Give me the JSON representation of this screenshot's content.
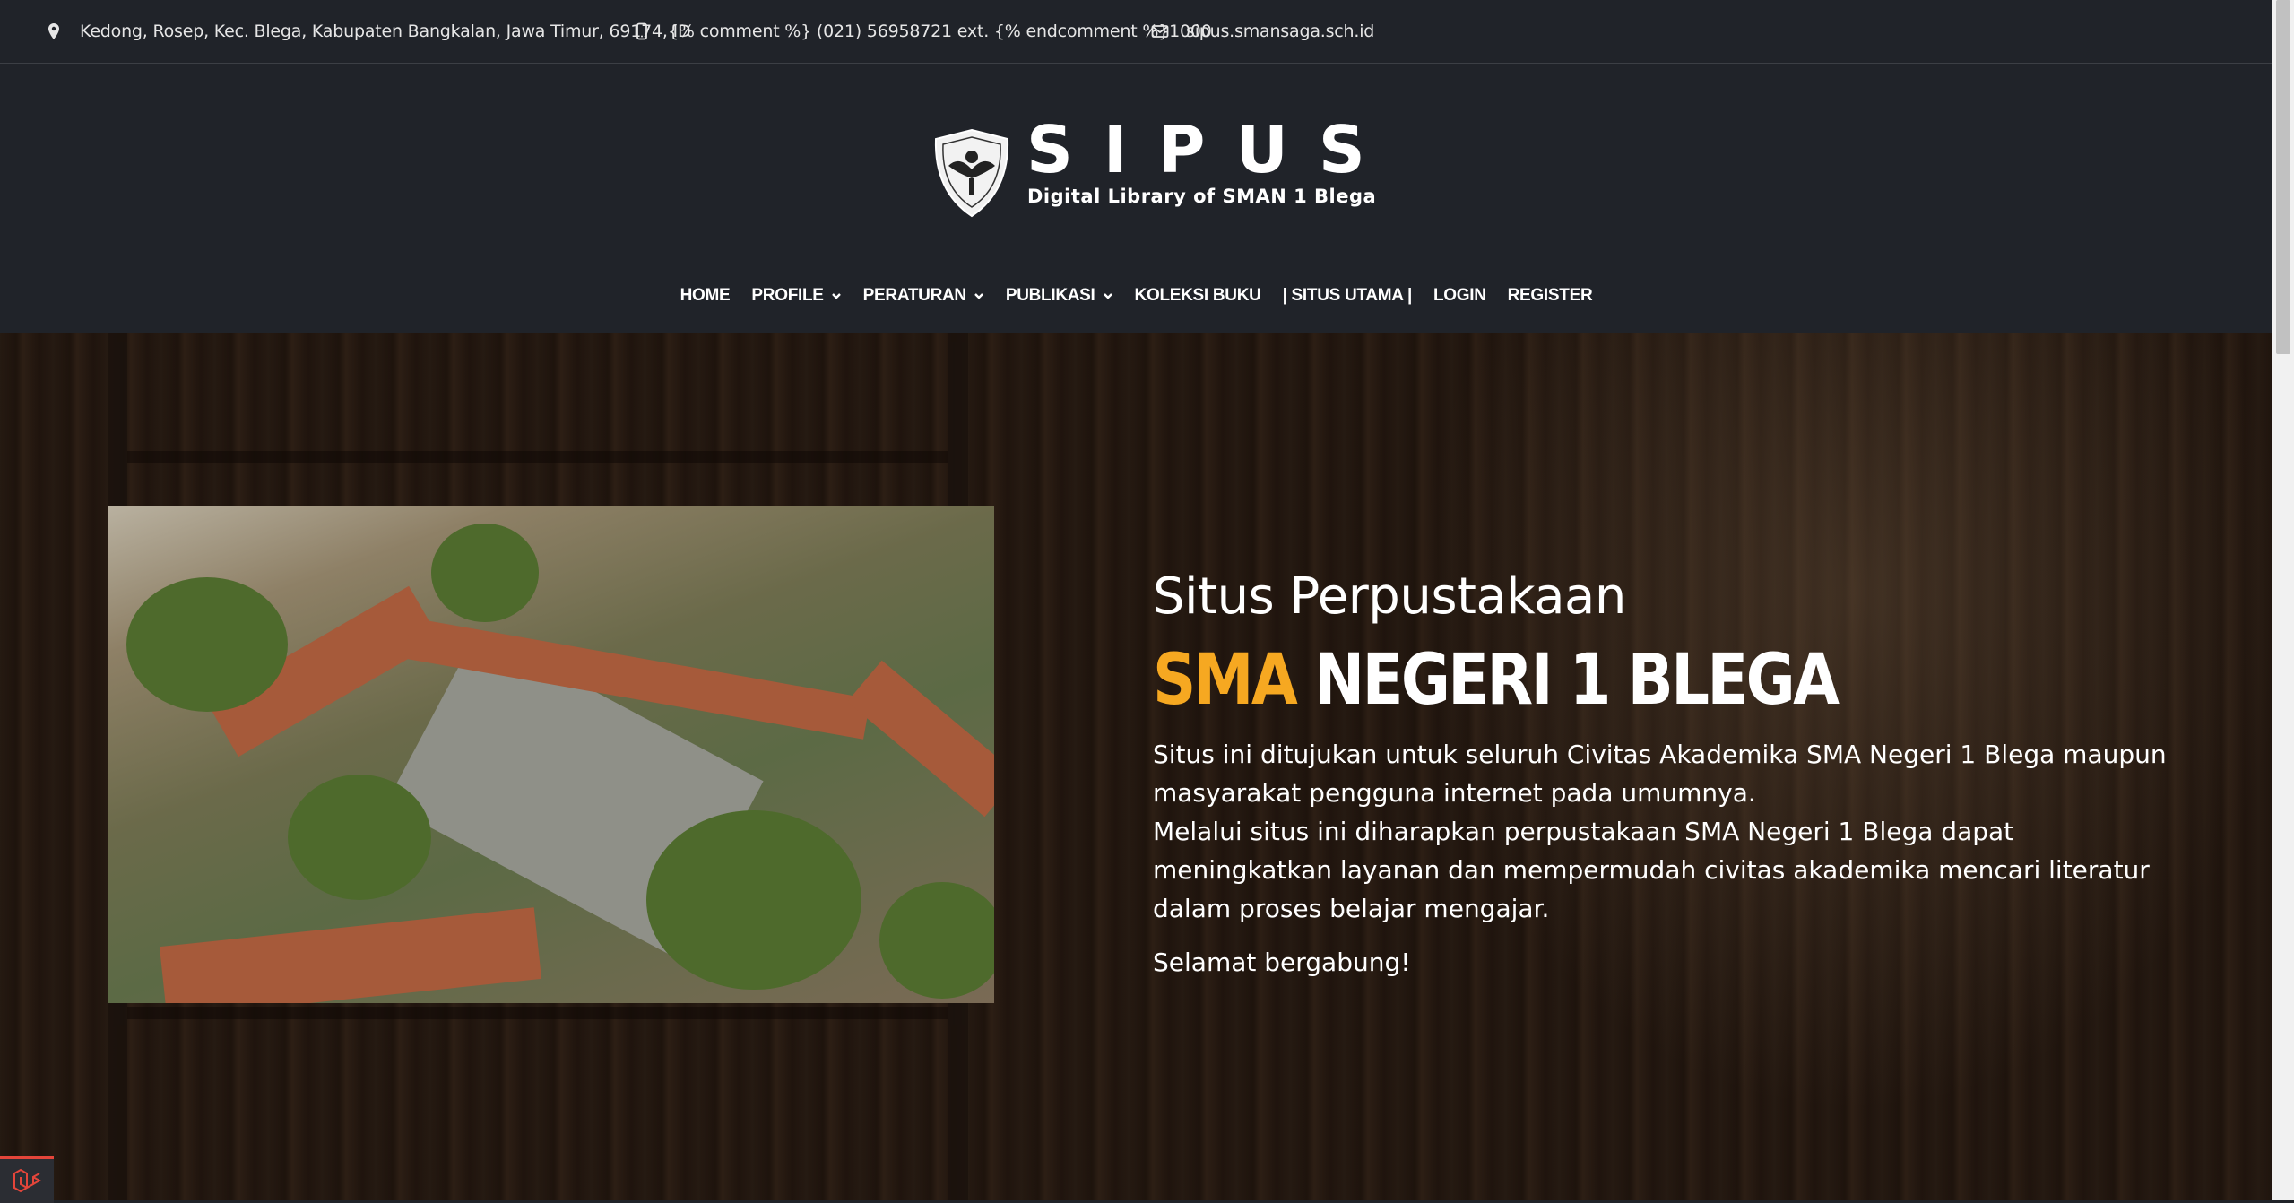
{
  "topbar": {
    "address": "Kedong, Rosep, Kec. Blega, Kabupaten Bangkalan, Jawa Timur, 69174, ID",
    "phone": "{% comment %} (021) 56958721 ext. {% endcomment %}1000",
    "email": "sipus.smansaga.sch.id"
  },
  "brand": {
    "name": "SIPUS",
    "tagline": "Digital Library of SMAN 1 Blega"
  },
  "nav": {
    "items": [
      {
        "label": "HOME",
        "has_dropdown": false
      },
      {
        "label": "PROFILE",
        "has_dropdown": true
      },
      {
        "label": "PERATURAN",
        "has_dropdown": true
      },
      {
        "label": "PUBLIKASI",
        "has_dropdown": true
      },
      {
        "label": "KOLEKSI BUKU",
        "has_dropdown": false
      },
      {
        "label": "| SITUS UTAMA |",
        "has_dropdown": false
      },
      {
        "label": "LOGIN",
        "has_dropdown": false
      },
      {
        "label": "REGISTER",
        "has_dropdown": false
      }
    ]
  },
  "hero": {
    "subtitle": "Situs Perpustakaan",
    "title_accent": "SMA",
    "title_rest": "NEGERI 1 BLEGA",
    "desc_1": "Situs ini ditujukan untuk seluruh Civitas Akademika SMA Negeri 1 Blega maupun masyarakat pengguna internet pada umumnya.",
    "desc_2": "Melalui situs ini diharapkan perpustakaan SMA Negeri 1 Blega dapat meningkatkan layanan dan mempermudah civitas akademika mencari literatur dalam proses belajar mengajar.",
    "greeting": "Selamat bergabung!"
  },
  "colors": {
    "header_bg": "#202329",
    "accent": "#f6a821",
    "badge_red": "#e4453a"
  },
  "icons": {
    "address": "map-pin-icon",
    "phone": "phone-icon",
    "email": "envelope-icon",
    "dropdown": "chevron-down-icon",
    "badge": "laravel-icon"
  }
}
